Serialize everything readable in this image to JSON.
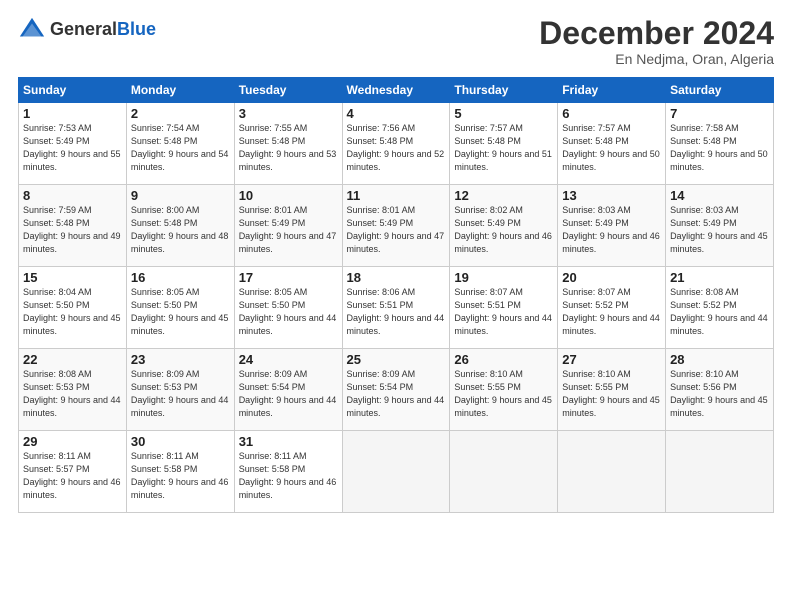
{
  "header": {
    "logo_general": "General",
    "logo_blue": "Blue",
    "month": "December 2024",
    "location": "En Nedjma, Oran, Algeria"
  },
  "weekdays": [
    "Sunday",
    "Monday",
    "Tuesday",
    "Wednesday",
    "Thursday",
    "Friday",
    "Saturday"
  ],
  "weeks": [
    [
      {
        "day": "1",
        "sunrise": "7:53 AM",
        "sunset": "5:49 PM",
        "daylight": "9 hours and 55 minutes."
      },
      {
        "day": "2",
        "sunrise": "7:54 AM",
        "sunset": "5:48 PM",
        "daylight": "9 hours and 54 minutes."
      },
      {
        "day": "3",
        "sunrise": "7:55 AM",
        "sunset": "5:48 PM",
        "daylight": "9 hours and 53 minutes."
      },
      {
        "day": "4",
        "sunrise": "7:56 AM",
        "sunset": "5:48 PM",
        "daylight": "9 hours and 52 minutes."
      },
      {
        "day": "5",
        "sunrise": "7:57 AM",
        "sunset": "5:48 PM",
        "daylight": "9 hours and 51 minutes."
      },
      {
        "day": "6",
        "sunrise": "7:57 AM",
        "sunset": "5:48 PM",
        "daylight": "9 hours and 50 minutes."
      },
      {
        "day": "7",
        "sunrise": "7:58 AM",
        "sunset": "5:48 PM",
        "daylight": "9 hours and 50 minutes."
      }
    ],
    [
      {
        "day": "8",
        "sunrise": "7:59 AM",
        "sunset": "5:48 PM",
        "daylight": "9 hours and 49 minutes."
      },
      {
        "day": "9",
        "sunrise": "8:00 AM",
        "sunset": "5:48 PM",
        "daylight": "9 hours and 48 minutes."
      },
      {
        "day": "10",
        "sunrise": "8:01 AM",
        "sunset": "5:49 PM",
        "daylight": "9 hours and 47 minutes."
      },
      {
        "day": "11",
        "sunrise": "8:01 AM",
        "sunset": "5:49 PM",
        "daylight": "9 hours and 47 minutes."
      },
      {
        "day": "12",
        "sunrise": "8:02 AM",
        "sunset": "5:49 PM",
        "daylight": "9 hours and 46 minutes."
      },
      {
        "day": "13",
        "sunrise": "8:03 AM",
        "sunset": "5:49 PM",
        "daylight": "9 hours and 46 minutes."
      },
      {
        "day": "14",
        "sunrise": "8:03 AM",
        "sunset": "5:49 PM",
        "daylight": "9 hours and 45 minutes."
      }
    ],
    [
      {
        "day": "15",
        "sunrise": "8:04 AM",
        "sunset": "5:50 PM",
        "daylight": "9 hours and 45 minutes."
      },
      {
        "day": "16",
        "sunrise": "8:05 AM",
        "sunset": "5:50 PM",
        "daylight": "9 hours and 45 minutes."
      },
      {
        "day": "17",
        "sunrise": "8:05 AM",
        "sunset": "5:50 PM",
        "daylight": "9 hours and 44 minutes."
      },
      {
        "day": "18",
        "sunrise": "8:06 AM",
        "sunset": "5:51 PM",
        "daylight": "9 hours and 44 minutes."
      },
      {
        "day": "19",
        "sunrise": "8:07 AM",
        "sunset": "5:51 PM",
        "daylight": "9 hours and 44 minutes."
      },
      {
        "day": "20",
        "sunrise": "8:07 AM",
        "sunset": "5:52 PM",
        "daylight": "9 hours and 44 minutes."
      },
      {
        "day": "21",
        "sunrise": "8:08 AM",
        "sunset": "5:52 PM",
        "daylight": "9 hours and 44 minutes."
      }
    ],
    [
      {
        "day": "22",
        "sunrise": "8:08 AM",
        "sunset": "5:53 PM",
        "daylight": "9 hours and 44 minutes."
      },
      {
        "day": "23",
        "sunrise": "8:09 AM",
        "sunset": "5:53 PM",
        "daylight": "9 hours and 44 minutes."
      },
      {
        "day": "24",
        "sunrise": "8:09 AM",
        "sunset": "5:54 PM",
        "daylight": "9 hours and 44 minutes."
      },
      {
        "day": "25",
        "sunrise": "8:09 AM",
        "sunset": "5:54 PM",
        "daylight": "9 hours and 44 minutes."
      },
      {
        "day": "26",
        "sunrise": "8:10 AM",
        "sunset": "5:55 PM",
        "daylight": "9 hours and 45 minutes."
      },
      {
        "day": "27",
        "sunrise": "8:10 AM",
        "sunset": "5:55 PM",
        "daylight": "9 hours and 45 minutes."
      },
      {
        "day": "28",
        "sunrise": "8:10 AM",
        "sunset": "5:56 PM",
        "daylight": "9 hours and 45 minutes."
      }
    ],
    [
      {
        "day": "29",
        "sunrise": "8:11 AM",
        "sunset": "5:57 PM",
        "daylight": "9 hours and 46 minutes."
      },
      {
        "day": "30",
        "sunrise": "8:11 AM",
        "sunset": "5:58 PM",
        "daylight": "9 hours and 46 minutes."
      },
      {
        "day": "31",
        "sunrise": "8:11 AM",
        "sunset": "5:58 PM",
        "daylight": "9 hours and 46 minutes."
      },
      null,
      null,
      null,
      null
    ]
  ]
}
